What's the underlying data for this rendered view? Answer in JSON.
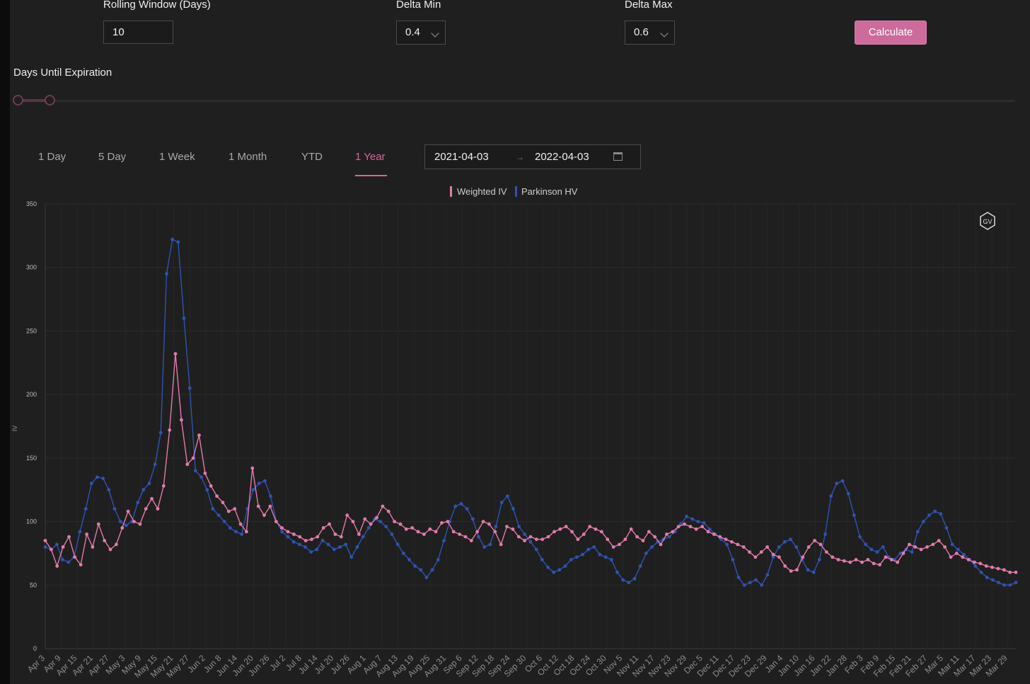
{
  "controls": {
    "rolling_window": {
      "label": "Rolling Window (Days)",
      "value": "10"
    },
    "delta_min": {
      "label": "Delta Min",
      "value": "0.4"
    },
    "delta_max": {
      "label": "Delta Max",
      "value": "0.6"
    },
    "calculate_label": "Calculate",
    "days_until_expiration_label": "Days Until Expiration",
    "dte_slider": {
      "min": 0,
      "max": 1,
      "low": 0,
      "high": 0.033
    }
  },
  "tabs": [
    {
      "label": "1 Day",
      "active": false
    },
    {
      "label": "5 Day",
      "active": false
    },
    {
      "label": "1 Week",
      "active": false
    },
    {
      "label": "1 Month",
      "active": false
    },
    {
      "label": "YTD",
      "active": false
    },
    {
      "label": "1 Year",
      "active": true
    }
  ],
  "date_range": {
    "start": "2021-04-03",
    "end": "2022-04-03",
    "separator_icon": "arrow-right-icon",
    "calendar_icon": "calendar-icon"
  },
  "colors": {
    "weighted_iv": "#e47aab",
    "parkinson_hv": "#2f53b4",
    "accent": "#cc6b9c"
  },
  "watermark_text": "GV",
  "chart_data": {
    "type": "line",
    "title": "",
    "xlabel": "",
    "ylabel": "IV",
    "ylim": [
      0,
      350
    ],
    "yticks": [
      0,
      50,
      100,
      150,
      200,
      250,
      300,
      350
    ],
    "grid": true,
    "legend": "top-center",
    "x_tick_labels": [
      "Apr 3",
      "Apr 9",
      "Apr 15",
      "Apr 21",
      "Apr 27",
      "May 3",
      "May 9",
      "May 15",
      "May 21",
      "May 27",
      "Jun 2",
      "Jun 8",
      "Jun 14",
      "Jun 20",
      "Jun 26",
      "Jul 2",
      "Jul 8",
      "Jul 14",
      "Jul 20",
      "Jul 26",
      "Aug 1",
      "Aug 7",
      "Aug 13",
      "Aug 19",
      "Aug 25",
      "Aug 31",
      "Sep 6",
      "Sep 12",
      "Sep 18",
      "Sep 24",
      "Sep 30",
      "Oct 6",
      "Oct 12",
      "Oct 18",
      "Oct 24",
      "Oct 30",
      "Nov 5",
      "Nov 11",
      "Nov 17",
      "Nov 23",
      "Nov 29",
      "Dec 5",
      "Dec 11",
      "Dec 17",
      "Dec 23",
      "Dec 29",
      "Jan 4",
      "Jan 10",
      "Jan 16",
      "Jan 22",
      "Jan 28",
      "Feb 3",
      "Feb 9",
      "Feb 15",
      "Feb 21",
      "Feb 27",
      "Mar 5",
      "Mar 11",
      "Mar 17",
      "Mar 23",
      "Mar 29"
    ],
    "series": [
      {
        "name": "Weighted IV",
        "values": [
          85,
          78,
          65,
          80,
          88,
          72,
          66,
          90,
          80,
          98,
          85,
          78,
          82,
          95,
          108,
          100,
          98,
          110,
          118,
          110,
          128,
          172,
          232,
          180,
          145,
          150,
          168,
          138,
          128,
          120,
          115,
          108,
          110,
          98,
          92,
          142,
          112,
          105,
          112,
          100,
          95,
          92,
          90,
          88,
          85,
          86,
          88,
          95,
          98,
          90,
          88,
          105,
          100,
          90,
          102,
          98,
          103,
          112,
          108,
          100,
          98,
          94,
          95,
          92,
          90,
          94,
          92,
          99,
          100,
          92,
          90,
          88,
          85,
          92,
          100,
          98,
          92,
          82,
          96,
          94,
          88,
          85,
          88,
          86,
          86,
          88,
          92,
          94,
          96,
          92,
          86,
          90,
          96,
          94,
          92,
          86,
          80,
          82,
          86,
          94,
          88,
          85,
          92,
          88,
          82,
          90,
          92,
          96,
          98,
          96,
          94,
          96,
          92,
          90,
          88,
          86,
          84,
          82,
          80,
          76,
          72,
          76,
          80,
          74,
          72,
          65,
          61,
          62,
          72,
          80,
          85,
          82,
          76,
          72,
          70,
          69,
          68,
          70,
          68,
          70,
          67,
          66,
          72,
          70,
          68,
          75,
          82,
          80,
          78,
          80,
          82,
          85,
          80,
          72,
          75,
          72,
          70,
          68,
          67,
          65,
          64,
          63,
          62,
          60,
          60
        ]
      },
      {
        "name": "Parkinson HV",
        "values": [
          80,
          78,
          82,
          70,
          68,
          72,
          92,
          110,
          130,
          135,
          134,
          125,
          110,
          100,
          97,
          100,
          115,
          125,
          130,
          145,
          170,
          295,
          322,
          320,
          260,
          205,
          140,
          135,
          125,
          110,
          105,
          100,
          95,
          92,
          90,
          110,
          125,
          130,
          132,
          120,
          100,
          92,
          88,
          84,
          82,
          80,
          76,
          78,
          85,
          82,
          78,
          80,
          82,
          72,
          80,
          88,
          95,
          102,
          100,
          96,
          90,
          82,
          75,
          70,
          65,
          62,
          56,
          62,
          70,
          85,
          100,
          112,
          114,
          110,
          102,
          88,
          80,
          82,
          96,
          115,
          120,
          110,
          96,
          90,
          84,
          78,
          70,
          64,
          60,
          62,
          65,
          70,
          72,
          74,
          78,
          80,
          74,
          72,
          70,
          60,
          54,
          52,
          55,
          65,
          75,
          80,
          84,
          86,
          88,
          92,
          98,
          104,
          102,
          100,
          99,
          94,
          90,
          86,
          82,
          70,
          56,
          50,
          52,
          54,
          50,
          58,
          72,
          80,
          84,
          86,
          80,
          70,
          62,
          60,
          70,
          90,
          120,
          130,
          132,
          122,
          105,
          88,
          82,
          78,
          76,
          80,
          72,
          70,
          75,
          78,
          76,
          92,
          100,
          105,
          108,
          106,
          95,
          82,
          78,
          74,
          70,
          65,
          60,
          56,
          54,
          52,
          50,
          50,
          52
        ]
      }
    ]
  }
}
